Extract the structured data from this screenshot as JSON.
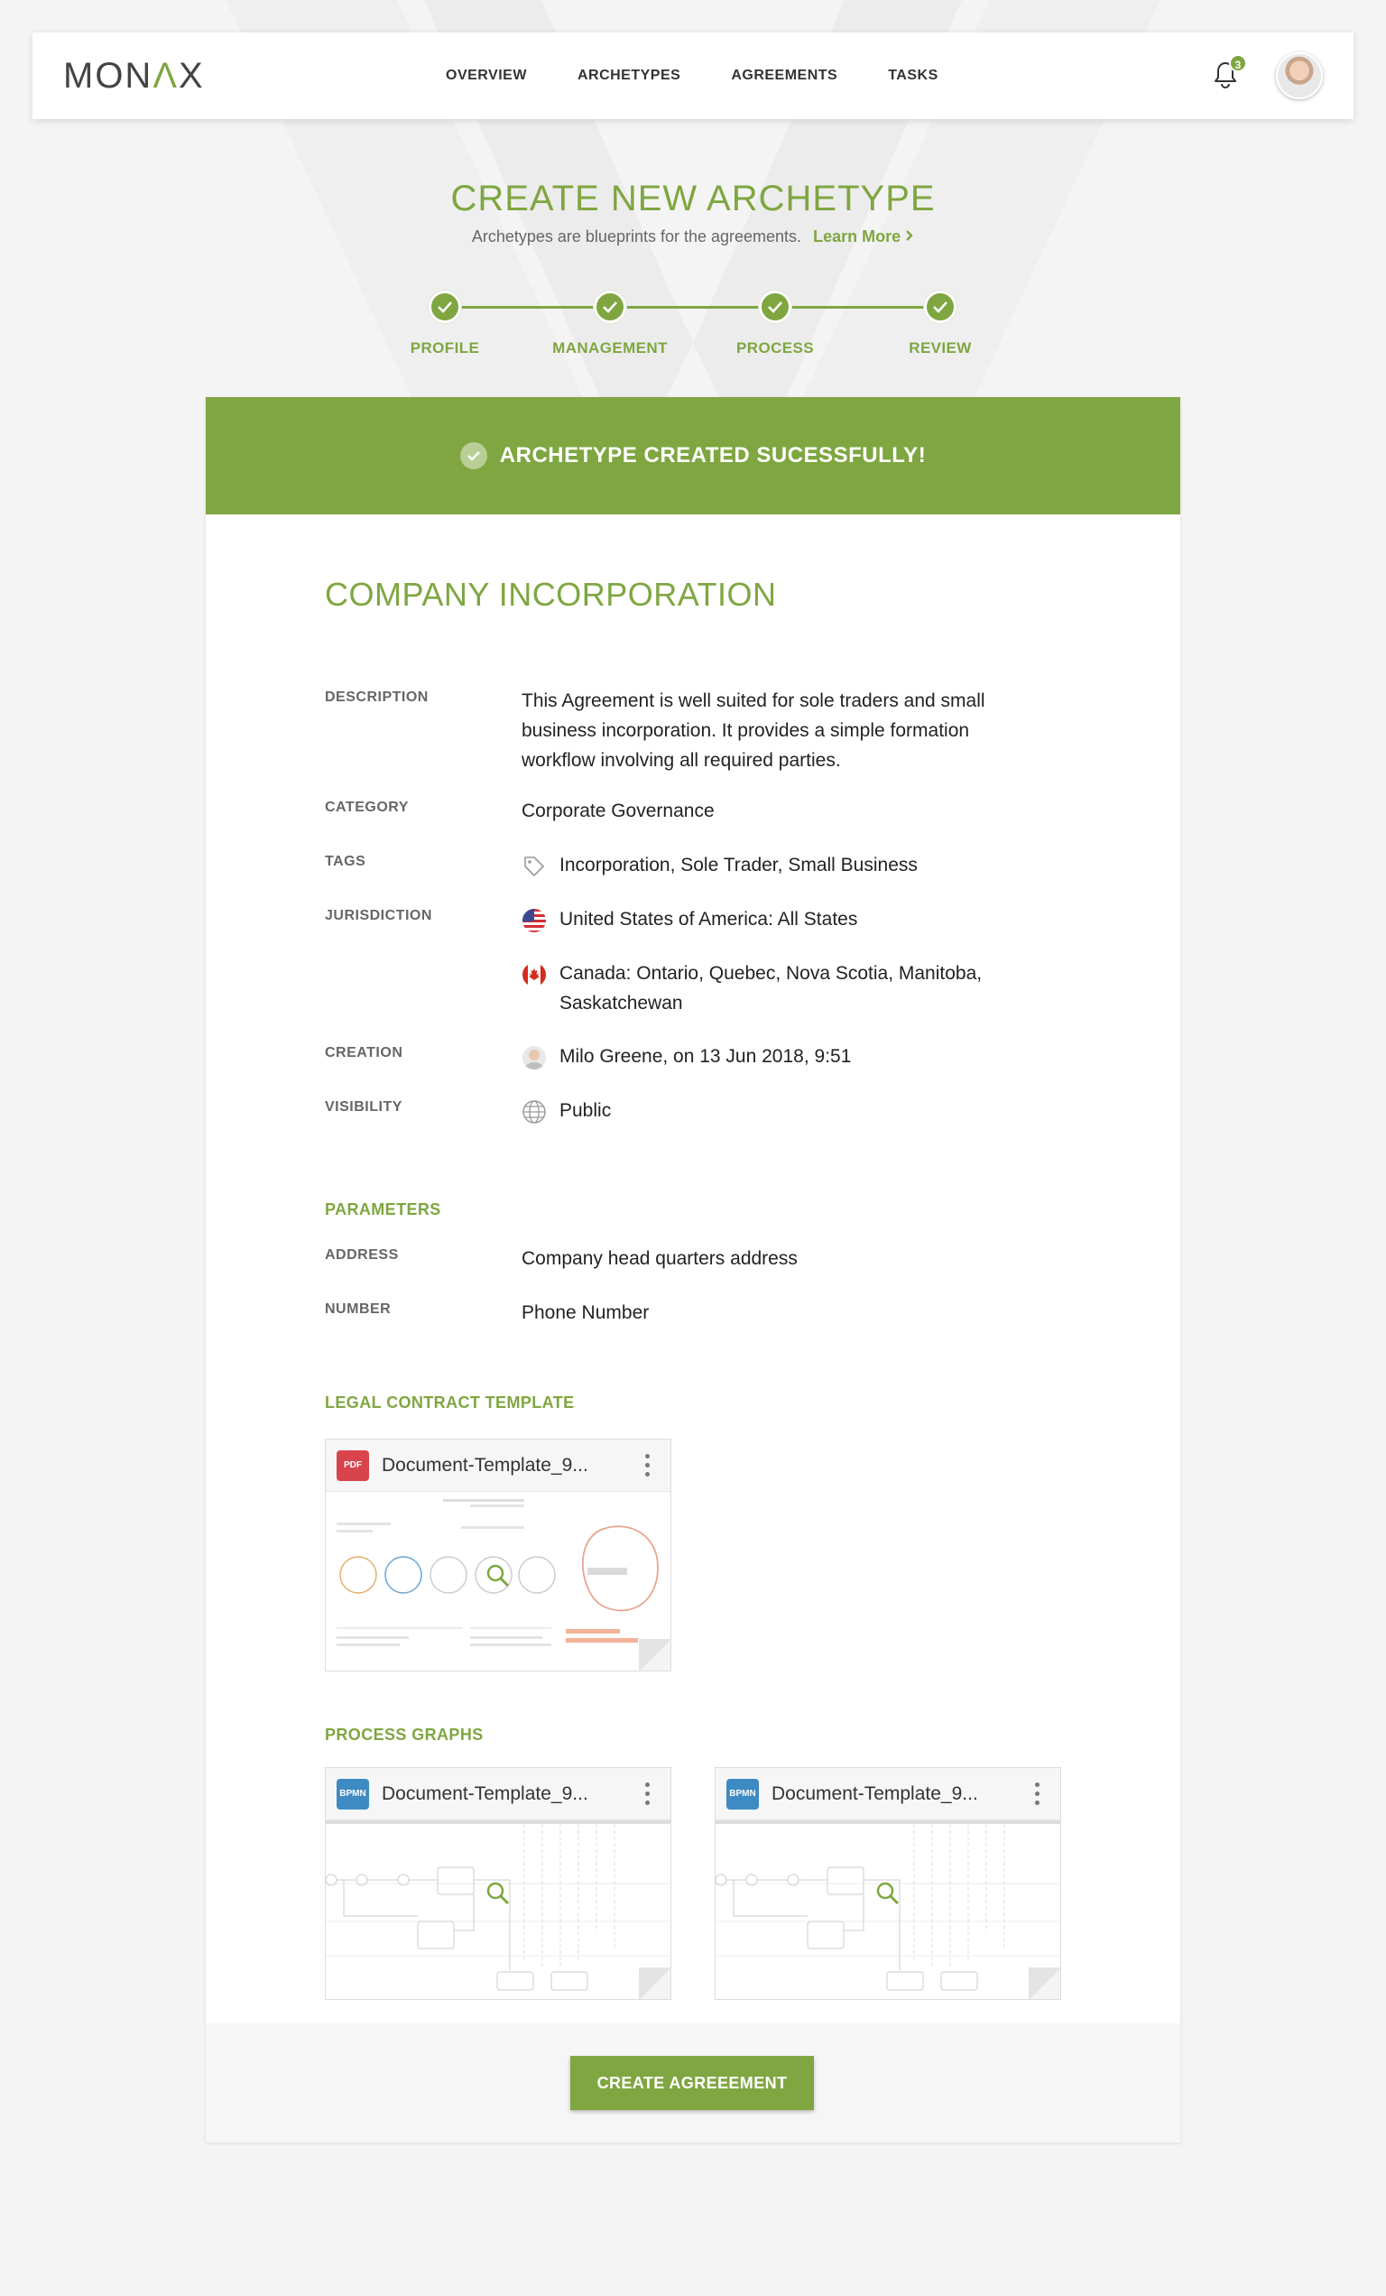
{
  "header": {
    "logo": "MONAX",
    "nav": [
      "OVERVIEW",
      "ARCHETYPES",
      "AGREEMENTS",
      "TASKS"
    ],
    "notifications_count": "3"
  },
  "hero": {
    "title": "CREATE NEW ARCHETYPE",
    "subtitle": "Archetypes are blueprints for the agreements.",
    "learn_more": "Learn More"
  },
  "steps": [
    "PROFILE",
    "MANAGEMENT",
    "PROCESS",
    "REVIEW"
  ],
  "banner": {
    "message": "ARCHETYPE CREATED SUCESSFULLY!"
  },
  "archetype": {
    "title": "COMPANY INCORPORATION",
    "description_label": "DESCRIPTION",
    "description": "This Agreement is well suited for sole traders and small business incorporation. It provides a simple formation workflow involving all required parties.",
    "category_label": "CATEGORY",
    "category": "Corporate Governance",
    "tags_label": "TAGS",
    "tags": "Incorporation, Sole Trader, Small Business",
    "jurisdiction_label": "JURISDICTION",
    "jurisdiction_us": "United States of America: All States",
    "jurisdiction_ca": "Canada: Ontario, Quebec, Nova Scotia, Manitoba, Saskatchewan",
    "creation_label": "CREATION",
    "creation": "Milo Greene, on 13 Jun 2018, 9:51",
    "visibility_label": "VISIBILITY",
    "visibility": "Public"
  },
  "parameters": {
    "heading": "PARAMETERS",
    "address_label": "ADDRESS",
    "address": "Company head quarters address",
    "number_label": "NUMBER",
    "number": "Phone Number"
  },
  "legal_template": {
    "heading": "LEGAL CONTRACT TEMPLATE",
    "file": {
      "badge": "PDF",
      "name": "Document-Template_9..."
    }
  },
  "process_graphs": {
    "heading": "PROCESS GRAPHS",
    "files": [
      {
        "badge": "BPMN",
        "name": "Document-Template_9..."
      },
      {
        "badge": "BPMN",
        "name": "Document-Template_9..."
      }
    ]
  },
  "cta": {
    "label": "CREATE AGREEEMENT"
  },
  "colors": {
    "accent": "#7fa641",
    "pdf": "#d9434b",
    "bpmn": "#3e8ac2"
  }
}
